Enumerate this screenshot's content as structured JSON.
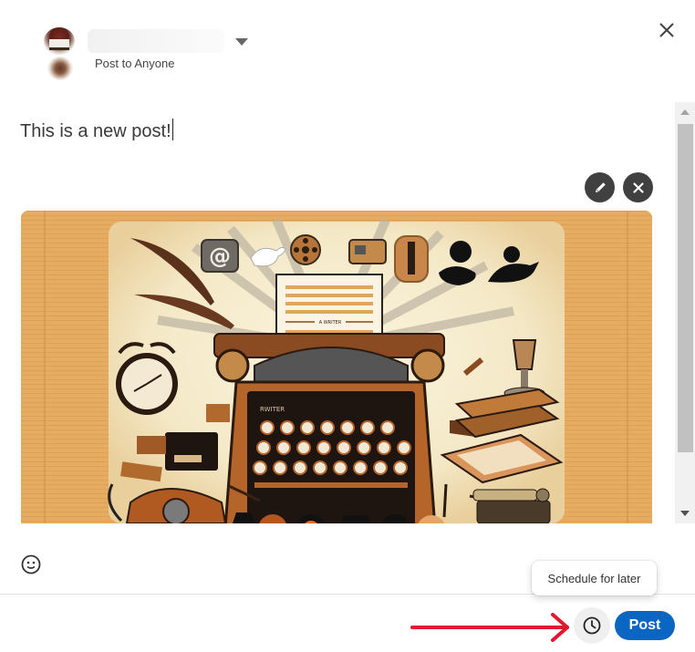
{
  "header": {
    "author_name": "",
    "audience_label": "Post to Anyone",
    "icons": {
      "dropdown": "caret-down-icon",
      "close": "close-icon"
    }
  },
  "editor": {
    "text": "This is a new post!",
    "media": {
      "description": "Vintage typewriter illustration surrounded by quills, clock, telephone, books and social media icons",
      "paper_label": "A WRITER",
      "typewriter_label": "RWITER",
      "edit_icon": "pencil-icon",
      "remove_icon": "close-icon"
    }
  },
  "footer": {
    "emoji_icon": "smiley-icon",
    "tooltip": "Schedule for later",
    "schedule_icon": "clock-icon",
    "post_label": "Post",
    "annotation_arrow_color": "#e0192f"
  },
  "colors": {
    "primary": "#0a66c2",
    "dark_button": "#404040",
    "arrow": "#e0192f"
  }
}
